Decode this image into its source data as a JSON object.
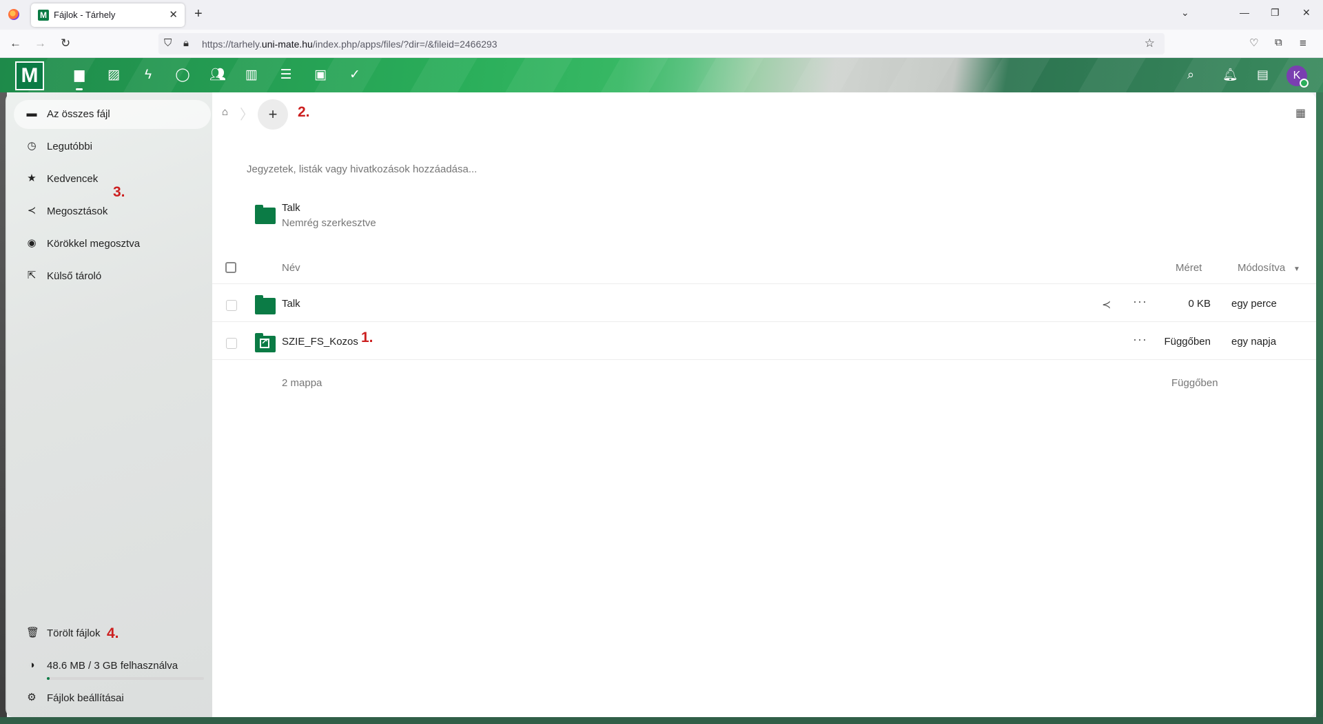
{
  "browser": {
    "tab_title": "Fájlok - Tárhely",
    "tab_favicon": "M",
    "url_prefix": "https://tarhely.",
    "url_domain": "uni-mate.hu",
    "url_path": "/index.php/apps/files/?dir=/&fileid=2466293"
  },
  "header": {
    "logo": "M",
    "avatar_initial": "K",
    "apps": [
      "files-icon",
      "photos-icon",
      "activity-icon",
      "talk-icon",
      "contacts-icon",
      "analytics-icon",
      "tasks-list-icon",
      "contacts-card-icon",
      "tasks-check-icon"
    ]
  },
  "sidebar": {
    "items": [
      {
        "label": "Az összes fájl",
        "icon": "folder-icon"
      },
      {
        "label": "Legutóbbi",
        "icon": "clock-icon"
      },
      {
        "label": "Kedvencek",
        "icon": "star-icon"
      },
      {
        "label": "Megosztások",
        "icon": "share-icon"
      },
      {
        "label": "Körökkel megosztva",
        "icon": "circles-icon"
      },
      {
        "label": "Külső tároló",
        "icon": "external-storage-icon"
      }
    ],
    "trash": "Törölt fájlok",
    "quota": "48.6 MB / 3 GB felhasználva",
    "quota_fraction": 0.016,
    "settings": "Fájlok beállításai"
  },
  "annotations": {
    "a1": "1.",
    "a2": "2.",
    "a3": "3.",
    "a4": "4."
  },
  "main": {
    "rich_workspace_placeholder": "Jegyzetek, listák vagy hivatkozások hozzáadása...",
    "recent": {
      "name": "Talk",
      "subtitle": "Nemrég szerkesztve"
    },
    "columns": {
      "name": "Név",
      "size": "Méret",
      "modified": "Módosítva"
    },
    "rows": [
      {
        "name": "Talk",
        "size": "0 KB",
        "modified": "egy perce"
      },
      {
        "name": "SZIE_FS_Kozos",
        "size": "Függőben",
        "modified": "egy napja"
      }
    ],
    "summary": {
      "count": "2 mappa",
      "size": "Függőben"
    }
  },
  "colors": {
    "accent": "#0b7b45",
    "annotation": "#cc1f1f"
  }
}
